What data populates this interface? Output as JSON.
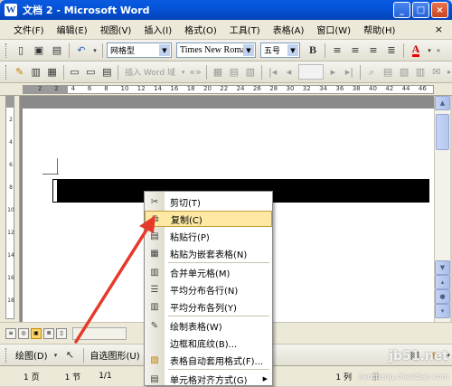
{
  "window": {
    "title": "文档 2 - Microsoft Word",
    "app_icon": "W"
  },
  "menubar": {
    "items": [
      "文件(F)",
      "编辑(E)",
      "视图(V)",
      "插入(I)",
      "格式(O)",
      "工具(T)",
      "表格(A)",
      "窗口(W)",
      "帮助(H)"
    ],
    "close_doc": "×"
  },
  "toolbar_format": {
    "style": "网格型",
    "font": "Times New Romar",
    "size": "五号",
    "bold": "B",
    "font_color": "A"
  },
  "toolbar_mail": {
    "insert_word_field": "插入 Word 域"
  },
  "ruler": {
    "labels": [
      "2",
      "2",
      "4",
      "6",
      "8",
      "10",
      "12",
      "14",
      "16",
      "18",
      "20",
      "22",
      "24",
      "26",
      "28",
      "30",
      "32",
      "34",
      "36",
      "38",
      "40",
      "42",
      "44",
      "46"
    ]
  },
  "vruler": {
    "labels": [
      "2",
      "4",
      "6",
      "8",
      "10",
      "12",
      "14",
      "16",
      "18"
    ]
  },
  "context_menu": {
    "items": [
      {
        "label": "剪切(T)",
        "icon": "scissors-icon"
      },
      {
        "label": "复制(C)",
        "icon": "copy-icon"
      },
      {
        "label": "粘贴行(P)",
        "icon": "paste-icon"
      },
      {
        "label": "粘贴为嵌套表格(N)",
        "icon": "paste-nested-icon"
      },
      {
        "label": "合并单元格(M)",
        "icon": "merge-cells-icon"
      },
      {
        "label": "平均分布各行(N)",
        "icon": "distribute-rows-icon"
      },
      {
        "label": "平均分布各列(Y)",
        "icon": "distribute-columns-icon"
      },
      {
        "label": "绘制表格(W)",
        "icon": "draw-table-icon"
      },
      {
        "label": "边框和底纹(B)...",
        "icon": ""
      },
      {
        "label": "表格自动套用格式(F)...",
        "icon": "autoformat-icon"
      },
      {
        "label": "单元格对齐方式(G)",
        "icon": "cell-align-icon"
      }
    ],
    "highlighted": "复制(C)"
  },
  "draw_toolbar": {
    "draw": "绘图(D)",
    "autoshapes": "自选图形(U)"
  },
  "statusbar": {
    "page": "1 页",
    "section": "1 节",
    "pages": "1/1",
    "col": "1 列",
    "rec": "录"
  },
  "watermark": {
    "main": "jb51.net",
    "sub": "jiaocheng.chazidian.com"
  },
  "colors": {
    "title_bar": "#0553d8",
    "highlight": "#fde9a3",
    "arrow": "#e53a2a"
  }
}
